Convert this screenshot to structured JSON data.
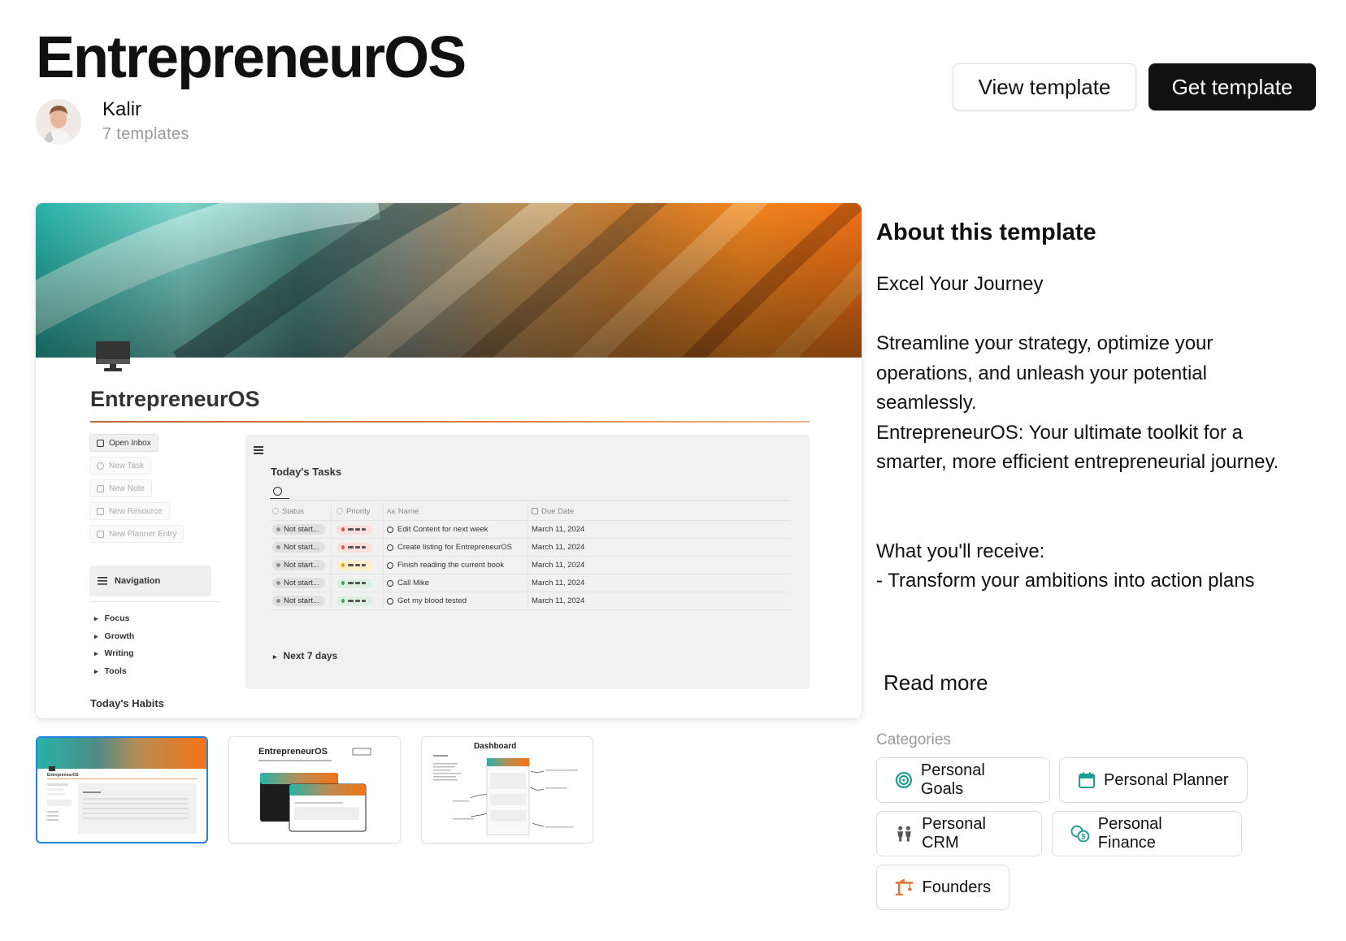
{
  "header": {
    "title": "EntrepreneurOS",
    "author_name": "Kalir",
    "author_templates": "7 templates",
    "view_label": "View template",
    "get_label": "Get template"
  },
  "preview": {
    "page_title": "EntrepreneurOS",
    "sidebar_buttons": [
      "Open Inbox",
      "New Task",
      "New Note",
      "New Resource",
      "New Planner Entry"
    ],
    "navigation_label": "Navigation",
    "nav_items": [
      "Focus",
      "Growth",
      "Writing",
      "Tools"
    ],
    "habits_label": "Today's Habits",
    "tasks": {
      "title": "Today's Tasks",
      "columns": [
        "Status",
        "Priority",
        "Name",
        "Due Date"
      ],
      "rows": [
        {
          "status": "Not start...",
          "priority": "high",
          "name": "Edit Content for next week",
          "due": "March 11, 2024"
        },
        {
          "status": "Not start...",
          "priority": "high",
          "name": "Create listing for EntrepreneurOS",
          "due": "March 11, 2024"
        },
        {
          "status": "Not start...",
          "priority": "med",
          "name": "Finish reading the current book",
          "due": "March 11, 2024"
        },
        {
          "status": "Not start...",
          "priority": "low",
          "name": "Call Mike",
          "due": "March 11, 2024"
        },
        {
          "status": "Not start...",
          "priority": "low",
          "name": "Get my blood tested",
          "due": "March 11, 2024"
        }
      ],
      "next_label": "Next 7 days"
    }
  },
  "thumbnails": {
    "t1_title": "EntrepreneurOS",
    "t2_title": "EntrepreneurOS",
    "t3_title": "Dashboard"
  },
  "about": {
    "heading": "About this template",
    "tagline": "Excel Your Journey",
    "paragraph_1": "Streamline your strategy, optimize your operations, and unleash your potential seamlessly.",
    "paragraph_2": "EntrepreneurOS: Your ultimate toolkit for a smarter, more efficient entrepreneurial journey.",
    "receive_heading": "What you'll receive:",
    "receive_item": "- Transform your ambitions into action plans",
    "read_more": "Read more"
  },
  "categories": {
    "label": "Categories",
    "items": [
      {
        "label": "Personal Goals",
        "icon": "target-icon",
        "color": "#1f9d8e"
      },
      {
        "label": "Personal Planner",
        "icon": "calendar-icon",
        "color": "#1f9d8e"
      },
      {
        "label": "Personal CRM",
        "icon": "people-icon",
        "color": "#555555"
      },
      {
        "label": "Personal Finance",
        "icon": "coins-icon",
        "color": "#1f9d8e"
      },
      {
        "label": "Founders",
        "icon": "crane-icon",
        "color": "#e6702e"
      }
    ]
  },
  "colors": {
    "accent": "#111111",
    "selected_border": "#2383e2",
    "muted_text": "#9a9a9a"
  }
}
